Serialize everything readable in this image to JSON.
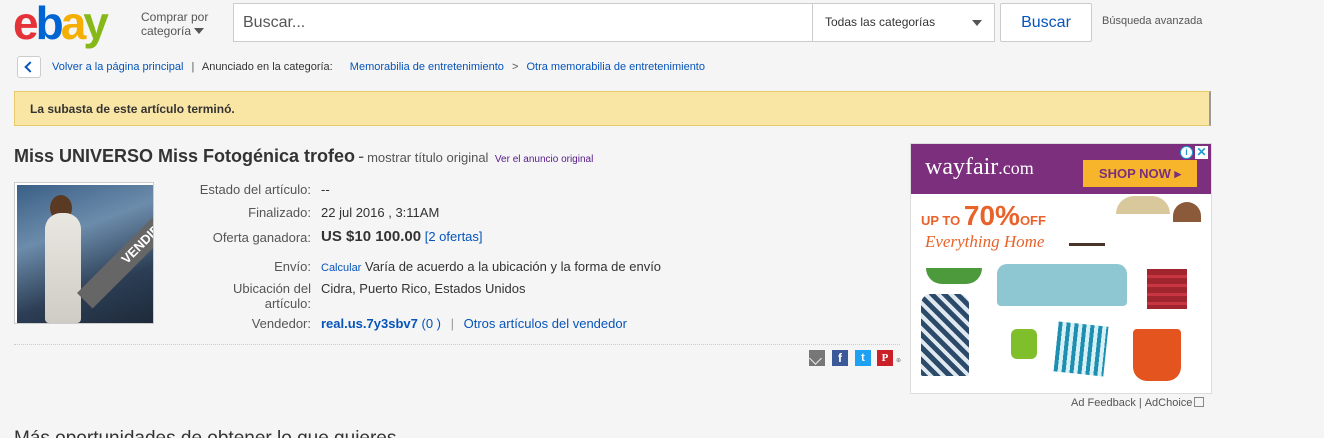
{
  "header": {
    "shop_by_line1": "Comprar por",
    "shop_by_line2": "categoría",
    "search_placeholder": "Buscar...",
    "category_selected": "Todas las categorías",
    "search_button": "Buscar",
    "advanced_search": "Búsqueda avanzada"
  },
  "breadcrumb": {
    "back_label": "Volver a la página principal",
    "listed_in": "Anunciado en la categoría:",
    "cat1": "Memorabilia de entretenimiento",
    "separator": ">",
    "cat2": "Otra memorabilia de entretenimiento"
  },
  "alert": {
    "message": "La subasta de este artículo terminó."
  },
  "item": {
    "title": "Miss UNIVERSO Miss Fotogénica trofeo",
    "dash": "-",
    "show_original": "mostrar título original",
    "see_original": "Ver el anuncio original",
    "sold_badge": "VENDIDO",
    "condition_label": "Estado del artículo:",
    "condition_value": "--",
    "ended_label": "Finalizado:",
    "ended_value": "22 jul 2016 , 3:11AM",
    "winning_label": "Oferta ganadora:",
    "winning_price": "US $10 100.00",
    "bids_open": "[",
    "bids_link": "2 ofertas",
    "bids_close": "]",
    "shipping_label": "Envío:",
    "shipping_calc": "Calcular",
    "shipping_text": "Varía de acuerdo a la ubicación y la forma de envío",
    "location_label_1": "Ubicación del",
    "location_label_2": "artículo:",
    "location_value": "Cidra, Puerto Rico, Estados Unidos",
    "seller_label": "Vendedor:",
    "seller_name": "real.us.7y3sbv7",
    "seller_feedback": "(0 )",
    "seller_pipe": "|",
    "seller_other": "Otros artículos del vendedor"
  },
  "share": {
    "icons": [
      "email-icon",
      "facebook-icon",
      "twitter-icon",
      "pinterest-icon"
    ]
  },
  "ad": {
    "brand": "wayfair",
    "brand_suffix": ".com",
    "shop_now": "SHOP NOW ▸",
    "offer_prefix": "UP TO",
    "offer_big": "70%",
    "offer_suffix": "OFF",
    "offer_sub": "Everything Home",
    "info_glyph": "i",
    "close_glyph": "✕",
    "feedback": "Ad Feedback",
    "pipe": "|",
    "adchoice": "AdChoice",
    "brand_color": "#7b2f7d",
    "accent_color": "#f7b52b"
  },
  "more_heading": "Más oportunidades de obtener lo que quieres"
}
